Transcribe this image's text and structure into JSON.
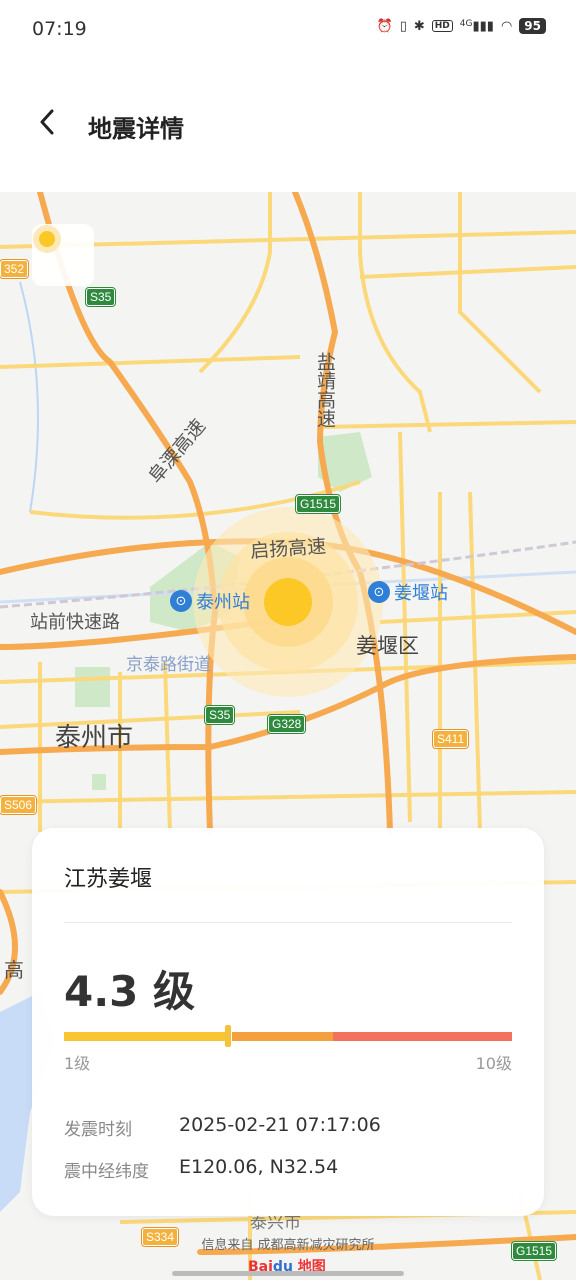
{
  "status_bar": {
    "time": "07:19",
    "battery": "95",
    "network": "4G",
    "hd": "HD"
  },
  "header": {
    "title": "地震详情"
  },
  "map": {
    "places": {
      "taizhou_city": "泰州市",
      "jiangyan_district": "姜堰区",
      "jingtai_street": "京泰路街道",
      "qiyang_expressway": "启扬高速",
      "yanjing_expressway": "盐靖高速",
      "fuli_expressway": "阜溧高速",
      "zhanqian_road": "站前快速路",
      "gao": "高",
      "bottom_city": "泰兴市"
    },
    "stations": {
      "taizhou": "泰州站",
      "jiangyan": "姜堰站"
    },
    "shields": {
      "s35_top": "S35",
      "s35_bottom": "S35",
      "g1515": "G1515",
      "g328": "G328",
      "s411": "S411",
      "s506": "S506",
      "s352": "352",
      "s334": "S334",
      "g1515_bottom": "G1515"
    },
    "colors": {
      "road_major": "#f6a94f",
      "road_minor": "#fbd87a",
      "green": "#bfe3c0",
      "water": "#bcd6f5"
    }
  },
  "card": {
    "location": "江苏姜堰",
    "magnitude": "4.3 级",
    "magnitude_value": 4.3,
    "scale": {
      "min_label": "1级",
      "max_label": "10级",
      "min": 1,
      "max": 10,
      "colors": [
        "#f9c531",
        "#f5a03e",
        "#f3715f"
      ]
    },
    "info": [
      {
        "label": "发震时刻",
        "value": "2025-02-21 07:17:06"
      },
      {
        "label": "震中经纬度",
        "value": "E120.06, N32.54"
      }
    ]
  },
  "footer": {
    "source": "信息来自 成都高新减灾研究所",
    "logo": "Baidu地图"
  }
}
